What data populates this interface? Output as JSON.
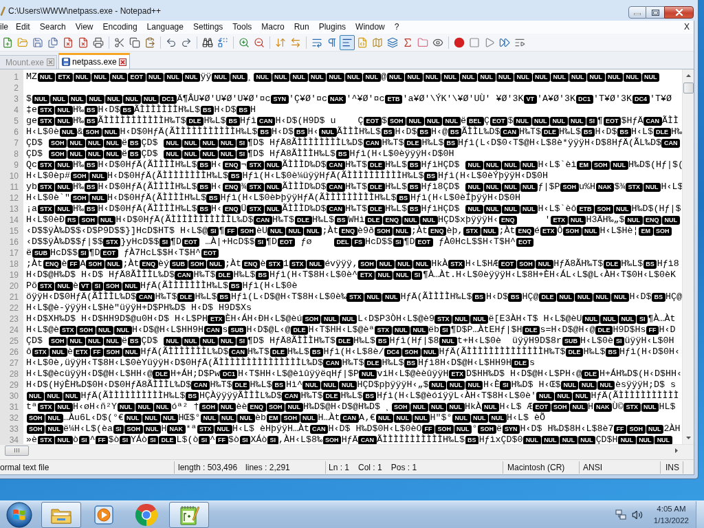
{
  "window": {
    "title": "C:\\Users\\WWW\\netpass.exe - Notepad++"
  },
  "menu": {
    "items": [
      "ile",
      "Edit",
      "Search",
      "View",
      "Encoding",
      "Language",
      "Settings",
      "Tools",
      "Macro",
      "Run",
      "Plugins",
      "Window",
      "?"
    ],
    "close": "X"
  },
  "toolbar": [
    {
      "kind": "new",
      "pressed": false
    },
    {
      "kind": "open",
      "pressed": false
    },
    {
      "kind": "save",
      "pressed": false
    },
    {
      "kind": "saveall",
      "pressed": false
    },
    {
      "kind": "close",
      "pressed": false
    },
    {
      "kind": "closeall",
      "pressed": false
    },
    {
      "kind": "print",
      "pressed": false
    },
    {
      "kind": "sep"
    },
    {
      "kind": "cut",
      "pressed": false
    },
    {
      "kind": "copy",
      "pressed": false
    },
    {
      "kind": "paste",
      "pressed": false
    },
    {
      "kind": "sep"
    },
    {
      "kind": "undo",
      "pressed": false
    },
    {
      "kind": "redo",
      "pressed": false
    },
    {
      "kind": "sep"
    },
    {
      "kind": "find",
      "pressed": false
    },
    {
      "kind": "replace",
      "pressed": false
    },
    {
      "kind": "sep"
    },
    {
      "kind": "zoomin",
      "pressed": false
    },
    {
      "kind": "zoomout",
      "pressed": false
    },
    {
      "kind": "sep"
    },
    {
      "kind": "syncv",
      "pressed": false
    },
    {
      "kind": "synch",
      "pressed": false
    },
    {
      "kind": "sep"
    },
    {
      "kind": "wrap",
      "pressed": false
    },
    {
      "kind": "allchars",
      "pressed": false
    },
    {
      "kind": "indent",
      "pressed": true
    },
    {
      "kind": "udl",
      "pressed": false
    },
    {
      "kind": "docmap",
      "pressed": false
    },
    {
      "kind": "doclist",
      "pressed": false
    },
    {
      "kind": "function",
      "pressed": false
    },
    {
      "kind": "folder",
      "pressed": false
    },
    {
      "kind": "monitor",
      "pressed": false
    },
    {
      "kind": "sep"
    },
    {
      "kind": "record",
      "pressed": false
    },
    {
      "kind": "stop",
      "pressed": false
    },
    {
      "kind": "play",
      "pressed": false
    },
    {
      "kind": "playmulti",
      "pressed": false
    },
    {
      "kind": "savemacro",
      "pressed": false
    }
  ],
  "tabs": [
    {
      "label": "Mount.exe",
      "selected": false
    },
    {
      "label": "netpass.exe",
      "selected": true
    }
  ],
  "editor": {
    "lines": [
      {
        "number": "1",
        "runs": [
          {
            "text": "MZ",
            "controls": [
              "NUL",
              "ETX",
              "NUL",
              "NUL",
              "NUL",
              "EOT",
              "NUL",
              "NUL",
              "NUL"
            ]
          },
          {
            "text": "ÿÿ",
            "controls": [
              "NUL",
              "NUL"
            ]
          },
          {
            "text": "¸",
            "controls": [
              "NUL",
              "NUL",
              "NUL",
              "NUL",
              "NUL",
              "NUL",
              "NUL"
            ]
          },
          {
            "text": "@",
            "controls": [
              "NUL",
              "NUL",
              "NUL",
              "NUL",
              "NUL",
              "NUL",
              "NUL",
              "NUL",
              "NUL",
              "NUL",
              "NUL",
              "NUL",
              "NUL",
              "NUL",
              "NUL"
            ]
          }
        ]
      },
      {
        "number": "2"
      },
      {
        "number": "3",
        "runs": [
          {
            "text": "$",
            "controls": [
              "NUL",
              "NUL",
              "NUL",
              "NUL",
              "NUL",
              "NUL",
              "NUL",
              "DC1"
            ]
          },
          {
            "text": "Ä¶ÂU¥Ø'U¥Ø'U¥Ø'¤c",
            "controls": [
              "SYN"
            ]
          },
          {
            "text": "'Ç¥Ø'¤c",
            "controls": [
              "NAK"
            ]
          },
          {
            "text": "'^¥Ø'¤c",
            "controls": [
              "ETB"
            ]
          },
          {
            "text": "'a¥Ø'\\ÝK'\\¥Ø'UÙ' ¥Ø'3K",
            "controls": [
              "VT"
            ]
          },
          {
            "text": "'A¥Ø'3K",
            "controls": [
              "DC1"
            ]
          },
          {
            "text": "'T¥Ø'3K",
            "controls": [
              "DC4"
            ]
          },
          {
            "text": "'T¥Ø"
          }
        ]
      },
      {
        "number": "4",
        "runs": [
          {
            "text": "‡e",
            "controls": [
              "STX",
              "NUL"
            ]
          },
          {
            "text": "H‰",
            "controls": [
              "BS"
            ]
          },
          {
            "text": "H‹D$",
            "controls": [
              "BS"
            ]
          },
          {
            "text": "ÃÌÌÌÌÌÌÌH‰L$",
            "controls": [
              "BS"
            ]
          },
          {
            "text": "H‹D$",
            "controls": [
              "BS"
            ]
          },
          {
            "text": "H"
          }
        ]
      },
      {
        "number": "5",
        "runs": [
          {
            "text": "ge",
            "controls": [
              "STX",
              "NUL"
            ]
          },
          {
            "text": "H‰",
            "controls": [
              "BS"
            ]
          },
          {
            "text": "ÃÌÌÌÌÌÌÌÌÌÌÌH‰T$",
            "controls": [
              "DLE"
            ]
          },
          {
            "text": "H‰L$",
            "controls": [
              "BS"
            ]
          },
          {
            "text": "Hƒì",
            "controls": [
              "CAN"
            ]
          },
          {
            "text": "H‹D$(H9D$ u    Ç",
            "controls": [
              "EOT"
            ]
          },
          {
            "text": "$",
            "controls": [
              "SOH",
              "NUL",
              "NUL",
              "NUL"
            ]
          },
          {
            "text": "ë",
            "controls": [
              "BEL"
            ]
          },
          {
            "text": "Ç",
            "controls": [
              "EOT"
            ]
          },
          {
            "text": "$",
            "controls": [
              "NUL",
              "NUL",
              "NUL",
              "NUL",
              "SI"
            ]
          },
          {
            "text": "¶",
            "controls": [
              "EOT"
            ]
          },
          {
            "text": "$HƒÄ",
            "controls": [
              "CAN"
            ]
          },
          {
            "text": "ÃÌÌ"
          }
        ]
      },
      {
        "number": "6",
        "runs": [
          {
            "text": "H‹L$0è",
            "controls": [
              "NUL"
            ]
          },
          {
            "text": "&",
            "controls": [
              "SOH",
              "NUL"
            ]
          },
          {
            "text": "H‹D$0HƒÄ(ÃÌÌÌÌÌÌÌÌÌÌÌH‰L$",
            "controls": [
              "BS"
            ]
          },
          {
            "text": "H‹D$",
            "controls": [
              "BS"
            ]
          },
          {
            "text": "H‹",
            "controls": [
              "NUL"
            ]
          },
          {
            "text": "ÃÌÌÌH‰L$",
            "controls": [
              "BS"
            ]
          },
          {
            "text": "H‹D$",
            "controls": [
              "BS"
            ]
          },
          {
            "text": "H‹@",
            "controls": [
              "BS"
            ]
          },
          {
            "text": "ÃÌÌL‰D$",
            "controls": [
              "CAN"
            ]
          },
          {
            "text": "H‰T$",
            "controls": [
              "DLE"
            ]
          },
          {
            "text": "H‰L$",
            "controls": [
              "BS"
            ]
          },
          {
            "text": "H‹D$",
            "controls": [
              "BS"
            ]
          },
          {
            "text": "H‹L$",
            "controls": [
              "DLE"
            ]
          },
          {
            "text": "H‰"
          }
        ]
      },
      {
        "number": "7",
        "runs": [
          {
            "text": "ÇD$ ",
            "controls": [
              "SOH",
              "NUL",
              "NUL",
              "NUL"
            ]
          },
          {
            "text": "ë",
            "controls": [
              "BS"
            ]
          },
          {
            "text": "ÇD$ ",
            "controls": [
              "NUL",
              "NUL",
              "NUL",
              "NUL",
              "SI"
            ]
          },
          {
            "text": "¶D$ HƒÄ8ÃÌÌÌÌÌÌÌÌL‰D$",
            "controls": [
              "CAN"
            ]
          },
          {
            "text": "H‰T$",
            "controls": [
              "DLE"
            ]
          },
          {
            "text": "H‰L$",
            "controls": [
              "BS"
            ]
          },
          {
            "text": "Hƒì(L‹D$0‹T$@H‹L$8è*ÿÿÿH‹D$8HƒÄ(ÃL‰D$",
            "controls": [
              "CAN"
            ]
          }
        ]
      },
      {
        "number": "8",
        "runs": [
          {
            "text": "ÇD$ ",
            "controls": [
              "SOH",
              "NUL",
              "NUL",
              "NUL"
            ]
          },
          {
            "text": "ë",
            "controls": [
              "BS"
            ]
          },
          {
            "text": "ÇD$ ",
            "controls": [
              "NUL",
              "NUL",
              "NUL",
              "NUL",
              "SI"
            ]
          },
          {
            "text": "¶D$ HƒÄ8ÃÌÌÌH‰L$",
            "controls": [
              "BS"
            ]
          },
          {
            "text": "Hƒì(H‹L$0èÿÿÿH‹D$0H"
          }
        ]
      },
      {
        "number": "9",
        "runs": [
          {
            "text": "Qc",
            "controls": [
              "STX",
              "NUL"
            ]
          },
          {
            "text": "H‰",
            "controls": [
              "BS"
            ]
          },
          {
            "text": "H‹D$0HƒÄ(ÃÌÌÌÌH‰L$",
            "controls": [
              "BS"
            ]
          },
          {
            "text": "H‹",
            "controls": [
              "ENQ"
            ]
          },
          {
            "text": "¬",
            "controls": [
              "STX",
              "NUL"
            ]
          },
          {
            "text": "ÃÌÌÌD‰D$",
            "controls": [
              "CAN"
            ]
          },
          {
            "text": "H‰T$",
            "controls": [
              "DLE"
            ]
          },
          {
            "text": "H‰L$",
            "controls": [
              "BS"
            ]
          },
          {
            "text": "HƒìHÇD$ ",
            "controls": [
              "NUL",
              "NUL",
              "NUL",
              "NUL"
            ]
          },
          {
            "text": "H‹L$`èì",
            "controls": [
              "EM",
              "SOH",
              "NUL"
            ]
          },
          {
            "text": "H‰D$(Hƒ|$("
          }
        ]
      },
      {
        "number": "10",
        "runs": [
          {
            "text": "H‹L$0èp#",
            "controls": [
              "SOH",
              "NUL"
            ]
          },
          {
            "text": "H‹D$0HƒÄ(ÃÌÌÌÌÌÌÌÌH‰L$",
            "controls": [
              "BS"
            ]
          },
          {
            "text": "Hƒì(H‹L$0è¼üÿÿHƒÄ(ÃÌÌÌÌÌÌÌÌÌÌH‰L$",
            "controls": [
              "BS"
            ]
          },
          {
            "text": "Hƒì(H‹L$0èÝþÿÿH‹D$0H"
          }
        ]
      },
      {
        "number": "11",
        "runs": [
          {
            "text": "yb",
            "controls": [
              "STX",
              "NUL"
            ]
          },
          {
            "text": "H‰",
            "controls": [
              "BS"
            ]
          },
          {
            "text": "H‹D$0HƒÄ(ÃÌÌÌÌH‰L$",
            "controls": [
              "BS"
            ]
          },
          {
            "text": "H‹",
            "controls": [
              "ENQ"
            ]
          },
          {
            "text": "¾",
            "controls": [
              "STX",
              "NUL"
            ]
          },
          {
            "text": "ÃÌÌÌD‰D$",
            "controls": [
              "CAN"
            ]
          },
          {
            "text": "H‰T$",
            "controls": [
              "DLE"
            ]
          },
          {
            "text": "H‰L$",
            "controls": [
              "BS"
            ]
          },
          {
            "text": "Hƒì8ÇD$ ",
            "controls": [
              "NUL",
              "NUL",
              "NUL",
              "NUL"
            ]
          },
          {
            "text": "ƒ|$P",
            "controls": [
              "SOH"
            ]
          },
          {
            "text": "u%H",
            "controls": [
              "NAK"
            ]
          },
          {
            "text": "$¾",
            "controls": [
              "STX",
              "NUL"
            ]
          },
          {
            "text": "H‹L$"
          }
        ]
      },
      {
        "number": "12",
        "runs": [
          {
            "text": "H‹L$0è`\"",
            "controls": [
              "SOH",
              "NUL"
            ]
          },
          {
            "text": "H‹D$0HƒÄ(ÃÌÌÌÌH‰L$",
            "controls": [
              "BS"
            ]
          },
          {
            "text": "Hƒì(H‹L$0èÞþÿÿHƒÄ(ÃÌÌÌÌÌÌÌÌÌH‰L$",
            "controls": [
              "BS"
            ]
          },
          {
            "text": "Hƒì(H‹L$0èÍþÿÿH‹D$0H"
          }
        ]
      },
      {
        "number": "13",
        "runs": [
          {
            "text": "¡a",
            "controls": [
              "STX",
              "NUL"
            ]
          },
          {
            "text": "H‰",
            "controls": [
              "BS"
            ]
          },
          {
            "text": "H‹D$0HƒÄ(ÃÌÌÌÌH‰L$",
            "controls": [
              "BS"
            ]
          },
          {
            "text": "H‹",
            "controls": [
              "ENQ"
            ]
          },
          {
            "text": "Ü",
            "controls": [
              "STX",
              "NUL"
            ]
          },
          {
            "text": "ÃÌÌÌD‰D$",
            "controls": [
              "CAN"
            ]
          },
          {
            "text": "H‰T$",
            "controls": [
              "DLE"
            ]
          },
          {
            "text": "H‰L$",
            "controls": [
              "BS"
            ]
          },
          {
            "text": "HƒìHÇD$ ",
            "controls": [
              "NUL",
              "NUL",
              "NUL",
              "NUL"
            ]
          },
          {
            "text": "H‹L$`èô",
            "controls": [
              "ETB",
              "SOH",
              "NUL"
            ]
          },
          {
            "text": "H‰D$(Hƒ|$"
          }
        ]
      },
      {
        "number": "14",
        "runs": [
          {
            "text": "H‹L$0èÐ",
            "controls": [
              "RS",
              "SOH",
              "NUL"
            ]
          },
          {
            "text": "H‹D$0HƒÄ(ÃÌÌÌÌÌÌÌÌÌÌÌL‰D$",
            "controls": [
              "CAN"
            ]
          },
          {
            "text": "H‰T$",
            "controls": [
              "DLE"
            ]
          },
          {
            "text": "H‰L$",
            "controls": [
              "BS"
            ]
          },
          {
            "text": "WHì",
            "controls": [
              "DLE",
              "ENQ",
              "NUL",
              "NUL"
            ]
          },
          {
            "text": "HÇD$xþÿÿÿH‹",
            "controls": [
              "ENQ"
            ]
          },
          {
            "text": "     '",
            "controls": [
              "ETX",
              "NUL"
            ]
          },
          {
            "text": "H3ÄH‰„$",
            "controls": [
              "NUL",
              "ENQ",
              "NUL"
            ]
          }
        ]
      },
      {
        "number": "15",
        "runs": [
          {
            "text": "‹D$$ÿÀ‰D$$‹D$P9D$$}]HcD$HT$ H‹L$@",
            "controls": [
              "SI"
            ]
          },
          {
            "text": "¶",
            "controls": [
              "FF",
              "SOH"
            ]
          },
          {
            "text": "èU",
            "controls": [
              "NUL",
              "NUL",
              "NUL"
            ]
          },
          {
            "text": ";Àt",
            "controls": [
              "ENQ"
            ]
          },
          {
            "text": "è9ð",
            "controls": [
              "SOH",
              "NUL"
            ]
          },
          {
            "text": ";Àt",
            "controls": [
              "ENQ"
            ]
          },
          {
            "text": "èþ,",
            "controls": [
              "STX",
              "NUL"
            ]
          },
          {
            "text": ";Àt",
            "controls": [
              "ENQ"
            ]
          },
          {
            "text": "é",
            "controls": [
              "ETX"
            ]
          },
          {
            "text": "Ô",
            "controls": [
              "SOH",
              "NUL"
            ]
          },
          {
            "text": "H‹L$Hè¦",
            "controls": [
              "EM",
              "SOH"
            ]
          }
        ]
      },
      {
        "number": "16",
        "runs": [
          {
            "text": "‹D$$ÿÀ‰D$$ƒ|$$",
            "controls": [
              "STX"
            ]
          },
          {
            "text": "}yHcD$$",
            "controls": [
              "SI"
            ]
          },
          {
            "text": "¶D",
            "controls": [
              "EOT"
            ]
          },
          {
            "text": " …À|+HcD$$",
            "controls": [
              "SI"
            ]
          },
          {
            "text": "¶D",
            "controls": [
              "EOT"
            ]
          },
          {
            "text": " ƒø    ",
            "controls": [
              "DEL",
              "FS"
            ]
          },
          {
            "text": "HcD$$",
            "controls": [
              "SI"
            ]
          },
          {
            "text": "¶D",
            "controls": [
              "EOT"
            ]
          },
          {
            "text": " ƒÀ0HcL$$H‹T$H^",
            "controls": [
              "EOT"
            ]
          }
        ]
      },
      {
        "number": "17",
        "runs": [
          {
            "text": "ë",
            "controls": [
              "SUB"
            ]
          },
          {
            "text": "HcD$$",
            "controls": [
              "SI"
            ]
          },
          {
            "text": "¶D",
            "controls": [
              "EOT"
            ]
          },
          {
            "text": " ƒÀ7HcL$$H‹T$H^",
            "controls": [
              "EOT"
            ]
          }
        ]
      },
      {
        "number": "18",
        "runs": [
          {
            "text": ";Àt",
            "controls": [
              "ENQ"
            ]
          },
          {
            "text": "è",
            "controls": [
              "FF"
            ]
          },
          {
            "text": "A",
            "controls": [
              "SOH",
              "NUL"
            ]
          },
          {
            "text": ";Àt",
            "controls": [
              "ENQ"
            ]
          },
          {
            "text": "èý",
            "controls": [
              "SUB",
              "SOH",
              "NUL"
            ]
          },
          {
            "text": ";Àt",
            "controls": [
              "ENQ"
            ]
          },
          {
            "text": "è",
            "controls": [
              "STX"
            ]
          },
          {
            "text": "1",
            "controls": [
              "STX",
              "NUL"
            ]
          },
          {
            "text": "évÿÿÿ‚",
            "controls": [
              "SOH",
              "NUL",
              "NUL",
              "NUL"
            ]
          },
          {
            "text": "HkÀ",
            "controls": [
              "STX"
            ]
          },
          {
            "text": "H‹L$HÆ",
            "controls": [
              "EOT",
              "SOH",
              "NUL"
            ]
          },
          {
            "text": "HƒÄ8ÃH‰T$",
            "controls": [
              "DLE"
            ]
          },
          {
            "text": "H‰L$",
            "controls": [
              "BS"
            ]
          },
          {
            "text": "Hƒì8"
          }
        ]
      },
      {
        "number": "19",
        "runs": [
          {
            "text": "H‹D$@H‰D$ H‹D$ HƒÄ8ÃÌÌÌL‰D$",
            "controls": [
              "CAN"
            ]
          },
          {
            "text": "H‰T$",
            "controls": [
              "DLE"
            ]
          },
          {
            "text": "H‰L$",
            "controls": [
              "BS"
            ]
          },
          {
            "text": "Hƒì(H‹T$8H‹L$0è^",
            "controls": [
              "ETX",
              "NUL",
              "NUL",
              "SI"
            ]
          },
          {
            "text": "¶À…Àt.H‹L$0èÿÿÿH‹L$8H+ÈH‹ÁL‹L$@L‹ÀH‹T$0H‹L$0èK"
          }
        ]
      },
      {
        "number": "20",
        "runs": [
          {
            "text": "Põ",
            "controls": [
              "STX",
              "NUL"
            ]
          },
          {
            "text": "è",
            "controls": [
              "VT",
              "SI",
              "SOH",
              "NUL"
            ]
          },
          {
            "text": "HƒÄ(ÃÌÌÌÌÌÌÌH‰L$",
            "controls": [
              "BS"
            ]
          },
          {
            "text": "Hƒì(H‹L$0è"
          }
        ]
      },
      {
        "number": "21",
        "runs": [
          {
            "text": "öÿÿH‹D$0HƒÄ(ÃÌÌÌL‰D$",
            "controls": [
              "CAN"
            ]
          },
          {
            "text": "H‰T$",
            "controls": [
              "DLE"
            ]
          },
          {
            "text": "H‰L$",
            "controls": [
              "BS"
            ]
          },
          {
            "text": "Hƒì(L‹D$@H‹T$8H‹L$0è‰",
            "controls": [
              "STX",
              "NUL",
              "NUL"
            ]
          },
          {
            "text": "HƒÄ(ÃÌÌÌÌH‰L$",
            "controls": [
              "BS"
            ]
          },
          {
            "text": "H‹D$",
            "controls": [
              "BS"
            ]
          },
          {
            "text": "HÇ@",
            "controls": [
              "DLE",
              "NUL",
              "NUL",
              "NUL",
              "NUL"
            ]
          },
          {
            "text": "H‹D$",
            "controls": [
              "BS"
            ]
          },
          {
            "text": "HÇ@"
          }
        ]
      },
      {
        "number": "22",
        "runs": [
          {
            "text": "H‹L$@è-ÿÿÿH‹L$Hè\"üÿÿH+D$PH‰D$ H‹D$ H9D$Xs"
          }
        ]
      },
      {
        "number": "23",
        "runs": [
          {
            "text": "H‹D$XH‰D$ H‹D$HH9D$@u0H‹D$ H‹L$PH",
            "controls": [
              "ETX"
            ]
          },
          {
            "text": "ÈH‹ÁH‹ÐH‹L$@èú",
            "controls": [
              "SOH",
              "NUL",
              "NUL"
            ]
          },
          {
            "text": "L‹D$P3ÒH‹L$@è9",
            "controls": [
              "STX",
              "NUL",
              "NUL"
            ]
          },
          {
            "text": "ë[E3ÀH‹T$ H‹L$@èU",
            "controls": [
              "NUL",
              "NUL",
              "NUL",
              "SI"
            ]
          },
          {
            "text": "¶À…Àt"
          }
        ]
      },
      {
        "number": "24",
        "runs": [
          {
            "text": "H‹L$@è",
            "controls": [
              "STX",
              "SOH",
              "NUL",
              "NUL"
            ]
          },
          {
            "text": "H‹D$@H‹L$HH9H",
            "controls": [
              "CAN"
            ]
          },
          {
            "text": "s",
            "controls": [
              "SUB"
            ]
          },
          {
            "text": "H‹D$@L‹@",
            "controls": [
              "DLE"
            ]
          },
          {
            "text": "H‹T$HH‹L$@èª",
            "controls": [
              "STX",
              "NUL",
              "NUL"
            ]
          },
          {
            "text": "ëb",
            "controls": [
              "SI"
            ]
          },
          {
            "text": "¶D$P…ÀtEHƒ|$H",
            "controls": [
              "DLE"
            ]
          },
          {
            "text": "s=H‹D$@H‹@",
            "controls": [
              "DLE"
            ]
          },
          {
            "text": "H9D$Hs",
            "controls": [
              "FF"
            ]
          },
          {
            "text": "H‹D"
          }
        ]
      },
      {
        "number": "25",
        "runs": [
          {
            "text": "ÇD$ ",
            "controls": [
              "SOH",
              "NUL",
              "NUL",
              "NUL"
            ]
          },
          {
            "text": "ë",
            "controls": [
              "BS"
            ]
          },
          {
            "text": "ÇD$ ",
            "controls": [
              "NUL",
              "NUL",
              "NUL",
              "NUL",
              "SI"
            ]
          },
          {
            "text": "¶D$ HƒÄ8ÃÌÌÌH‰T$",
            "controls": [
              "DLE"
            ]
          },
          {
            "text": "H‰L$",
            "controls": [
              "BS"
            ]
          },
          {
            "text": "Hƒì(Hƒ|$8",
            "controls": [
              "NUL"
            ]
          },
          {
            "text": "t+H‹L$0è  üÿÿH9D$8r",
            "controls": [
              "SUB"
            ]
          },
          {
            "text": "H‹L$0è",
            "controls": [
              "SI"
            ]
          },
          {
            "text": "üÿÿH‹L$0H"
          }
        ]
      },
      {
        "number": "26",
        "runs": [
          {
            "text": "ô",
            "controls": [
              "STX",
              "NUL"
            ]
          },
          {
            "text": "è",
            "controls": [
              "ETX",
              "FF",
              "SOH",
              "NUL"
            ]
          },
          {
            "text": "HƒÄ(ÃÌÌÌÌÌÌÌL‰D$",
            "controls": [
              "CAN"
            ]
          },
          {
            "text": "H‰T$",
            "controls": [
              "DLE"
            ]
          },
          {
            "text": "H‰L$",
            "controls": [
              "BS"
            ]
          },
          {
            "text": "Hƒì(H‹L$8è/",
            "controls": [
              "DC4",
              "SOH",
              "NUL"
            ]
          },
          {
            "text": "HƒÄ(ÃÌÌÌÌÌÌÌÌÌÌÌÌÌÌH‰T$",
            "controls": [
              "DLE"
            ]
          },
          {
            "text": "H‰L$",
            "controls": [
              "BS"
            ]
          },
          {
            "text": "Hƒì(H‹D$0H‹"
          }
        ]
      },
      {
        "number": "27",
        "runs": [
          {
            "text": "H‹L$0è‚üÿÿH‹T$8H‹L$0èYüÿÿH‹D$0HƒÄ(ÃÌÌÌÌÌÌÌÌÌÌÌÌÌÌÌL‰D$",
            "controls": [
              "CAN"
            ]
          },
          {
            "text": "H‰T$",
            "controls": [
              "DLE"
            ]
          },
          {
            "text": "H‰L$",
            "controls": [
              "BS"
            ]
          },
          {
            "text": "Hƒì8H‹D$@H‹L$HH9H",
            "controls": [
              "DLE"
            ]
          },
          {
            "text": "s"
          }
        ]
      },
      {
        "number": "28",
        "runs": [
          {
            "text": "H‹L$@ècüÿÿH‹D$@H‹L$HH‹@",
            "controls": [
              "DLE"
            ]
          },
          {
            "text": "H+ÁH;D$Pw",
            "controls": [
              "DC1"
            ]
          },
          {
            "text": "H‹T$HH‹L$@èìûÿÿëqHƒ|$P",
            "controls": [
              "NUL"
            ]
          },
          {
            "text": "viH‹L$@èèûÿÿH",
            "controls": [
              "ETX"
            ]
          },
          {
            "text": "D$HH‰D$ H‹D$@H‹L$PH‹@",
            "controls": [
              "DLE"
            ]
          },
          {
            "text": "H+ÁH‰D$(H‹D$HH‹"
          }
        ]
      },
      {
        "number": "29",
        "runs": [
          {
            "text": "H‹D$(HýÈH‰D$0H‹D$0HƒÄ8ÃÌÌÌL‰D$",
            "controls": [
              "CAN"
            ]
          },
          {
            "text": "H‰T$",
            "controls": [
              "DLE"
            ]
          },
          {
            "text": "H‰L$",
            "controls": [
              "BS"
            ]
          },
          {
            "text": "Hì^",
            "controls": [
              "NUL",
              "NUL",
              "NUL"
            ]
          },
          {
            "text": "HÇD$pþÿÿÿH‹„$",
            "controls": [
              "NUL",
              "NUL",
              "NUL"
            ]
          },
          {
            "text": "H‹È",
            "controls": [
              "SI"
            ]
          },
          {
            "text": "H‰D$ H‹Œ$",
            "controls": [
              "NUL",
              "NUL",
              "NUL"
            ]
          },
          {
            "text": "èsÿÿÿH;D$ s"
          }
        ]
      },
      {
        "number": "30",
        "runs": [
          {
            "controls": [
              "NUL",
              "NUL",
              "NUL"
            ]
          },
          {
            "text": "HƒÄ(ÃÌÌÌÌÌÌÌÌÌÌH‰L$",
            "controls": [
              "BS"
            ]
          },
          {
            "text": "HÇÀÿÿÿÿÃÌÌÌL‰D$",
            "controls": [
              "CAN"
            ]
          },
          {
            "text": "H‰T$",
            "controls": [
              "DLE"
            ]
          },
          {
            "text": "H‰L$",
            "controls": [
              "BS"
            ]
          },
          {
            "text": "Hƒì(H‹L$@èóíÿÿL‹ÀH‹T$8H‹L$0è'",
            "controls": [
              "NUL",
              "NUL",
              "NUL"
            ]
          },
          {
            "text": "HƒÄ(ÃÌÌÌÌÌÌÌÌÌÌÌ"
          }
        ]
      },
      {
        "number": "31",
        "runs": [
          {
            "text": "tª",
            "controls": [
              "STX",
              "NUL"
            ]
          },
          {
            "text": "H‹øH‹ñ²Y",
            "controls": [
              "NUL",
              "NUL",
              "NUL"
            ]
          },
          {
            "text": "óª² †",
            "controls": [
              "SOH",
              "NUL"
            ]
          },
          {
            "text": "èè",
            "controls": [
              "ENQ",
              "SOH",
              "NUL"
            ]
          },
          {
            "text": "H‰D$@H‹D$@H‰D$ ¸",
            "controls": [
              "SOH",
              "NUL",
              "NUL",
              "NUL"
            ]
          },
          {
            "text": "HkÀ",
            "controls": [
              "NUL"
            ]
          },
          {
            "text": "H‹L$ Æ",
            "controls": [
              "EOT",
              "SOH",
              "NUL"
            ]
          },
          {
            "text": "H",
            "controls": [
              "NAK"
            ]
          },
          {
            "text": "Ù©",
            "controls": [
              "STX",
              "NUL"
            ]
          },
          {
            "text": "HL$"
          }
        ]
      },
      {
        "number": "32",
        "runs": [
          {
            "controls": [
              "SOH",
              "NUL"
            ]
          },
          {
            "text": "…Àu6L‹D$(°€",
            "controls": [
              "NUL",
              "NUL",
              "NUL"
            ]
          },
          {
            "text": "HŒ$°",
            "controls": [
              "NUL",
              "NUL",
              "NUL"
            ]
          },
          {
            "text": "èb",
            "controls": [
              "EM",
              "SOH",
              "NUL"
            ]
          },
          {
            "text": "H…Àt",
            "controls": [
              "CAN"
            ]
          },
          {
            "text": "A‚€",
            "controls": [
              "NUL",
              "NUL",
              "NUL"
            ]
          },
          {
            "text": "H\"$°",
            "controls": [
              "NUL",
              "NUL",
              "NUL"
            ]
          },
          {
            "text": "H‹L$ èÕ"
          }
        ]
      },
      {
        "number": "33",
        "runs": [
          {
            "controls": [
              "SOH",
              "NUL"
            ]
          },
          {
            "text": "ë¼H‹L$(èa",
            "controls": [
              "SI",
              "SOH",
              "NUL"
            ]
          },
          {
            "text": "H",
            "controls": [
              "NAK"
            ]
          },
          {
            "text": "*ª",
            "controls": [
              "STX",
              "NUL"
            ]
          },
          {
            "text": "H‹L$ èHþÿÿH…Àt",
            "controls": [
              "CAN"
            ]
          },
          {
            "text": "H‹D$ H‰D$0H‹L$0èO",
            "controls": [
              "FF",
              "SOH",
              "NUL"
            ]
          },
          {
            "text": "°",
            "controls": [
              "SOH"
            ]
          },
          {
            "text": "ë",
            "controls": [
              "SYN"
            ]
          },
          {
            "text": "H‹D$ H‰D$8H‹L$8è7",
            "controls": [
              "FF",
              "SOH",
              "NUL"
            ]
          },
          {
            "text": "2ÀH"
          }
        ]
      },
      {
        "number": "34",
        "runs": [
          {
            "text": "»è",
            "controls": [
              "STX",
              "NUL"
            ]
          },
          {
            "text": "ò",
            "controls": [
              "SI"
            ]
          },
          {
            "text": "^",
            "controls": [
              "FF"
            ]
          },
          {
            "text": "$ò",
            "controls": [
              "SI"
            ]
          },
          {
            "text": "YÁò",
            "controls": [
              "SI",
              "DLE"
            ]
          },
          {
            "text": "L$(ò",
            "controls": [
              "SI"
            ]
          },
          {
            "text": "^",
            "controls": [
              "FF"
            ]
          },
          {
            "text": "$ò",
            "controls": [
              "SI"
            ]
          },
          {
            "text": "XÁò",
            "controls": [
              "SI"
            ]
          },
          {
            "text": ",ÀH‹L$8‰",
            "controls": [
              "SOH"
            ]
          },
          {
            "text": "HƒÄ",
            "controls": [
              "CAN"
            ]
          },
          {
            "text": "ÃÌÌÌÌÌÌÌÌÌÌÌH‰L$",
            "controls": [
              "BS"
            ]
          },
          {
            "text": "HƒìxÇD$0",
            "controls": [
              "NUL",
              "NUL",
              "NUL",
              "NUL"
            ]
          },
          {
            "text": "ÇD$H",
            "controls": [
              "NUL",
              "NUL",
              "NUL"
            ]
          }
        ]
      }
    ]
  },
  "status_bar": {
    "cells": [
      [
        "ormal text file"
      ],
      [
        "length : 503,496",
        "lines : 2,291"
      ],
      [
        "Ln : 1",
        "Col : 1",
        "Pos : 1"
      ],
      [
        "Macintosh (CR)"
      ],
      [
        "ANSI"
      ],
      [
        "INS"
      ]
    ]
  },
  "taskbar": {
    "apps": [
      {
        "kind": "explorer",
        "running": true
      },
      {
        "kind": "player",
        "running": false
      },
      {
        "kind": "browser",
        "running": false
      },
      {
        "kind": "notepad",
        "running": true
      }
    ],
    "clock": {
      "time": "4:05 AM",
      "date": "1/13/2022"
    }
  }
}
